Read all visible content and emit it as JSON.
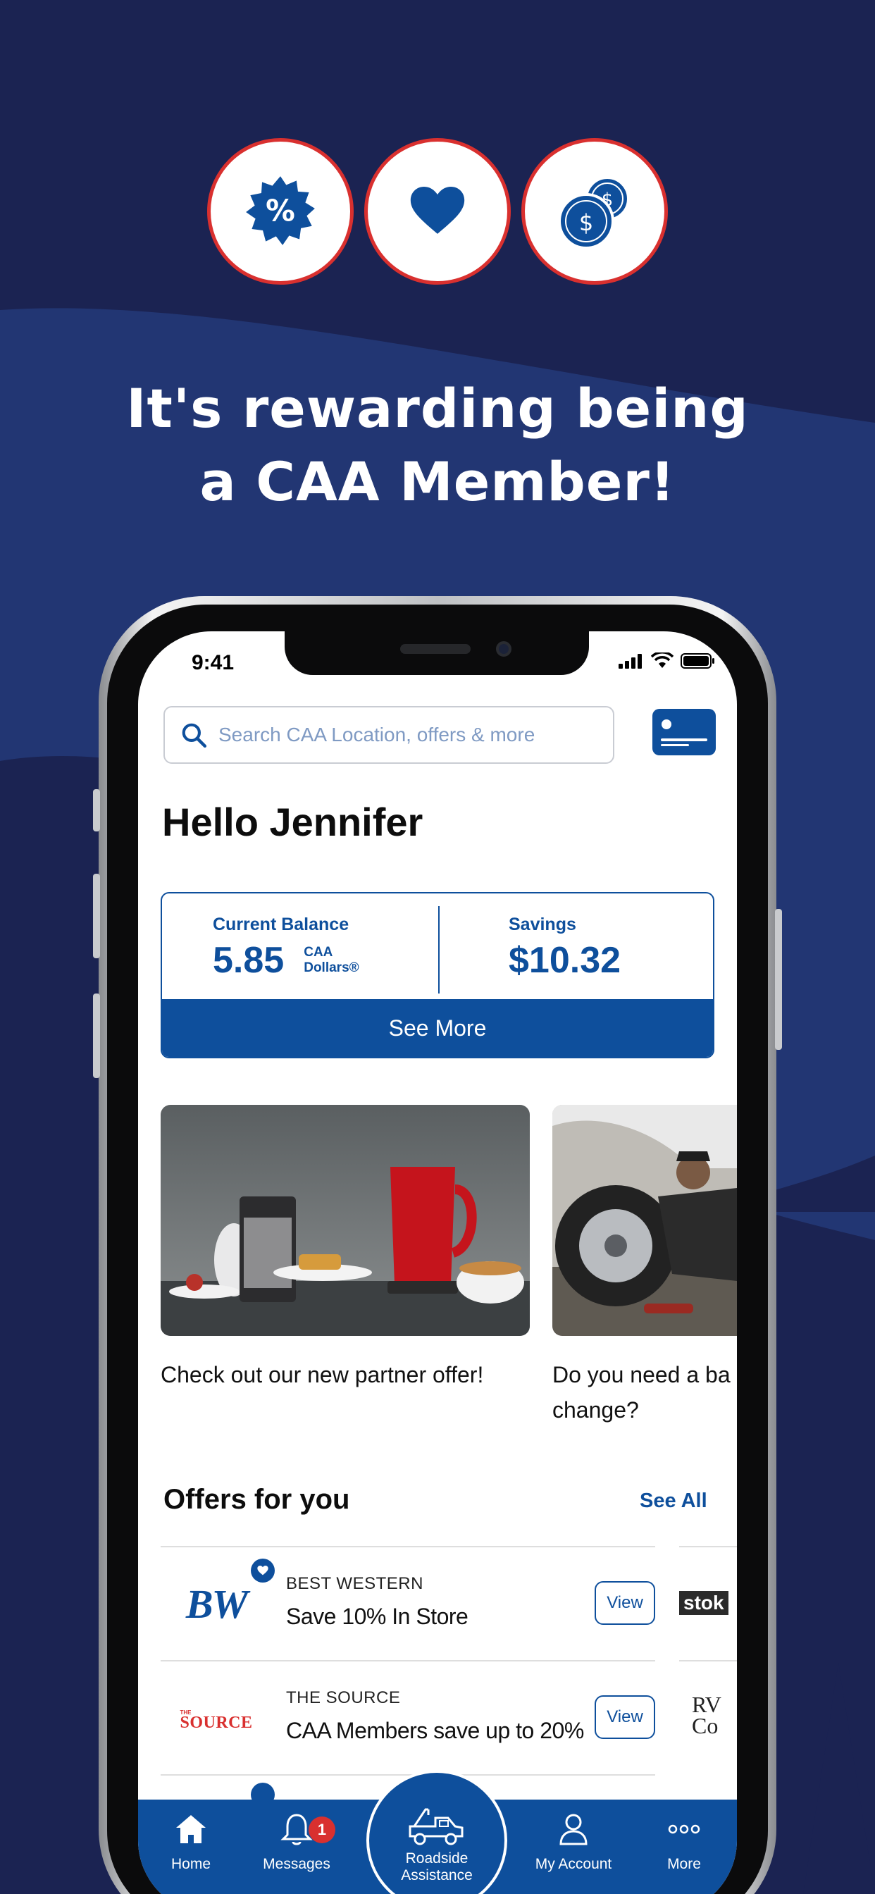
{
  "marketing": {
    "headline_line1": "It's rewarding being",
    "headline_line2": "a CAA Member!",
    "badges": [
      {
        "icon": "discount-badge-icon"
      },
      {
        "icon": "heart-icon"
      },
      {
        "icon": "coins-icon"
      }
    ]
  },
  "status_bar": {
    "time": "9:41"
  },
  "search": {
    "placeholder": "Search CAA Location, offers & more"
  },
  "greeting": "Hello Jennifer",
  "balance": {
    "current_label": "Current Balance",
    "current_value": "5.85",
    "unit_line1": "CAA",
    "unit_line2": "Dollars®",
    "savings_label": "Savings",
    "savings_value": "$10.32",
    "see_more_label": "See More"
  },
  "promos": [
    {
      "text": "Check out our new partner offer!"
    },
    {
      "text_line1": "Do you need a ba",
      "text_line2": "change?"
    }
  ],
  "offers": {
    "title": "Offers for you",
    "see_all_label": "See All",
    "items": [
      {
        "logo_text": "BW",
        "brand": "BEST WESTERN",
        "description": "Save 10% In Store",
        "view_label": "View",
        "favorite": true
      },
      {
        "logo_text": "THE SOURCE",
        "logo_small": "THE",
        "logo_main": "SOURCE",
        "brand": "THE SOURCE",
        "description": "CAA Members save up to 20%",
        "view_label": "View",
        "favorite": false
      }
    ],
    "peek": [
      "stok",
      "RV Co"
    ]
  },
  "tabbar": {
    "home": "Home",
    "messages": "Messages",
    "messages_badge": "1",
    "roadside_line1": "Roadside",
    "roadside_line2": "Assistance",
    "account": "My Account",
    "more": "More"
  },
  "colors": {
    "background": "#1b2352",
    "wave": "#223673",
    "brand_blue": "#0e4f9c",
    "badge_red": "#d9302f"
  }
}
